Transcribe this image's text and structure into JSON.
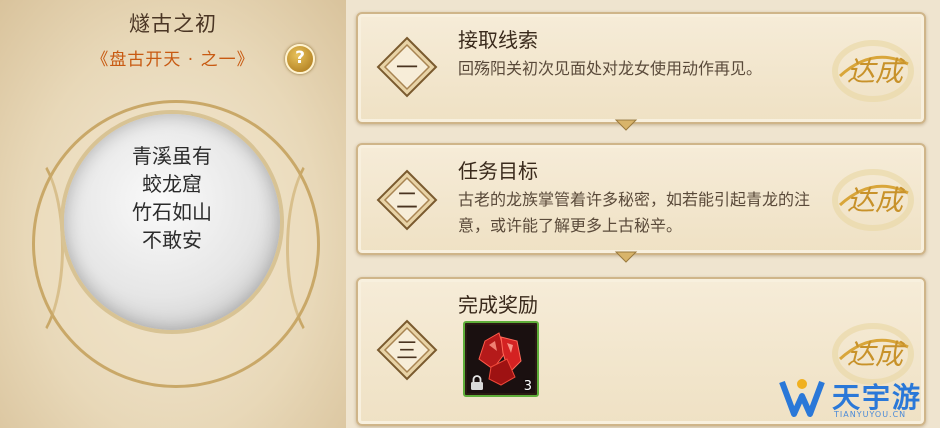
{
  "story": {
    "title": "燧古之初",
    "subtitle": "《盘古开天 · 之一》",
    "help_label": "?",
    "poem": [
      "青溪虽有",
      "蛟龙窟",
      "竹石如山",
      "不敢安"
    ]
  },
  "quest_steps": [
    {
      "numeral": "一",
      "title": "接取线索",
      "text": "回殇阳关初次见面处对龙女使用动作再见。",
      "status": "达成"
    },
    {
      "numeral": "二",
      "title": "任务目标",
      "text": "古老的龙族掌管着许多秘密，如若能引起青龙的注意，或许能了解更多上古秘辛。",
      "status": "达成"
    },
    {
      "numeral": "三",
      "title": "完成奖励",
      "reward": {
        "icon": "red-crystal-icon",
        "count": "3",
        "locked": true
      },
      "status": "达成"
    }
  ],
  "watermark": {
    "text": "天宇游",
    "url": "TIANYUYOU.CN"
  },
  "colors": {
    "accent_orange": "#c85a12",
    "stamp_gold": "#d9a63a",
    "reward_border": "#5fae3a",
    "watermark_blue": "#2a78d8"
  }
}
